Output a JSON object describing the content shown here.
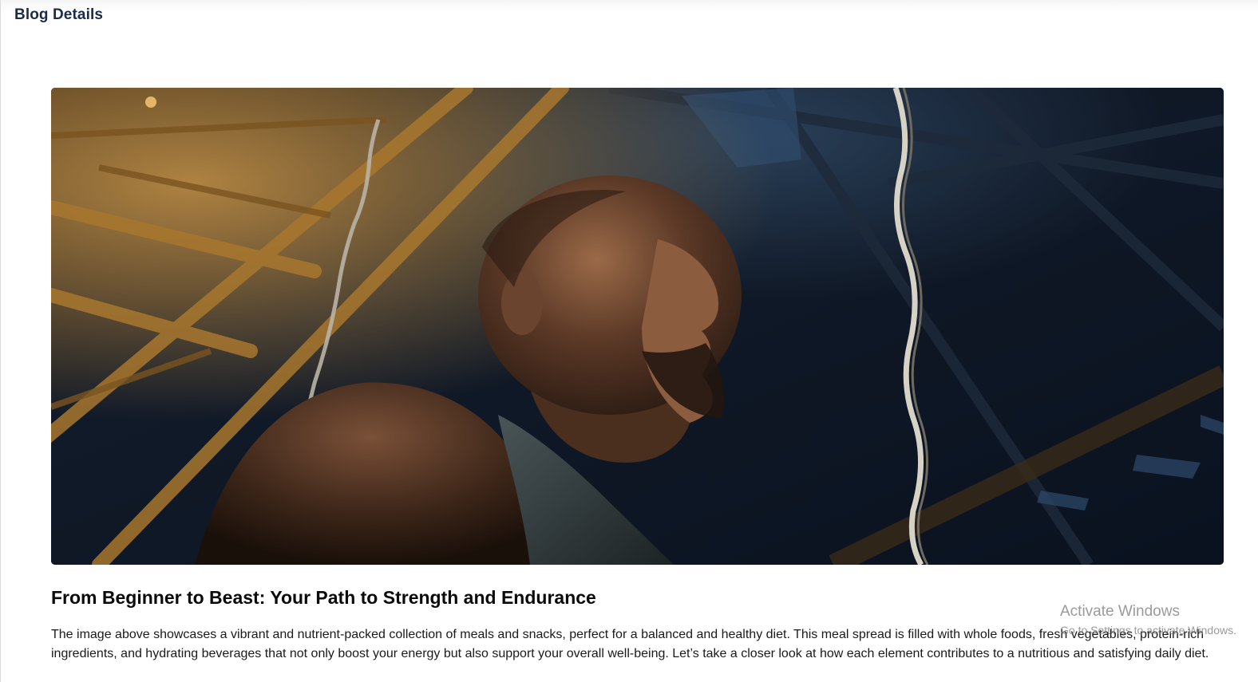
{
  "header": {
    "title": "Blog Details"
  },
  "hero": {
    "image_alt": "Athlete looking upward in an industrial gym with hanging chains"
  },
  "article": {
    "title": "From Beginner to Beast: Your Path to Strength and Endurance",
    "body": "The image above showcases a vibrant and nutrient-packed collection of meals and snacks, perfect for a balanced and healthy diet. This meal spread is filled with whole foods, fresh vegetables, protein-rich ingredients, and hydrating beverages that not only boost your energy but also support your overall well-being. Let’s take a closer look at how each element contributes to a nutritious and satisfying daily diet."
  },
  "watermark": {
    "title": "Activate Windows",
    "subtitle": "Go to Settings to activate Windows."
  },
  "colors": {
    "title_text": "#1b2b4a",
    "body_text": "#1a1a1a",
    "hero_dark": "#0e1624",
    "hero_warm": "#a8772e"
  }
}
